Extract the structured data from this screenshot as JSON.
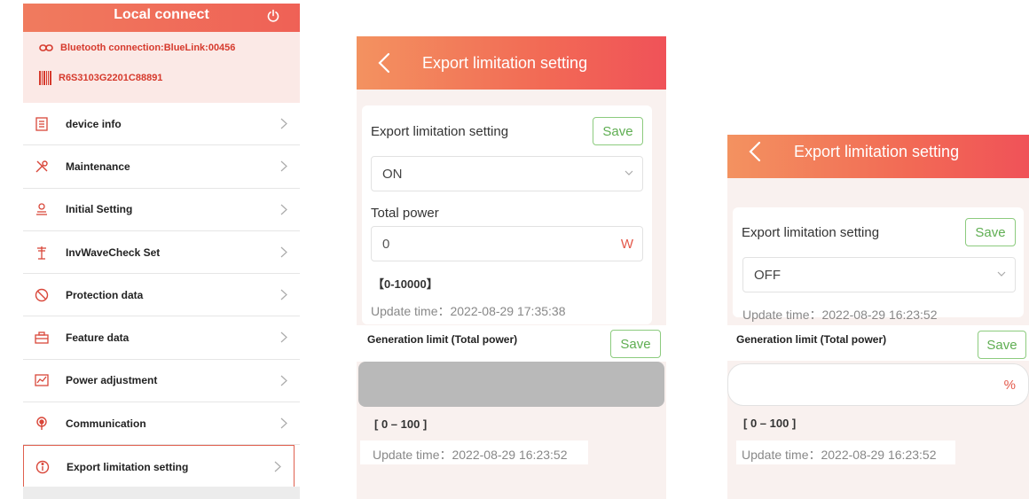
{
  "local": {
    "title": "Local connect",
    "bluetooth": "Bluetooth connection:BlueLink:00456",
    "serial": "R6S3103G2201C88891",
    "menu": [
      {
        "label": "device info",
        "icon": "document-icon"
      },
      {
        "label": "Maintenance",
        "icon": "tools-icon"
      },
      {
        "label": "Initial Setting",
        "icon": "setting-icon"
      },
      {
        "label": "InvWaveCheck Set",
        "icon": "tower-icon"
      },
      {
        "label": "Protection data",
        "icon": "prohibit-icon"
      },
      {
        "label": "Feature data",
        "icon": "toolbox-icon"
      },
      {
        "label": "Power adjustment",
        "icon": "chart-icon"
      },
      {
        "label": "Communication",
        "icon": "antenna-icon"
      },
      {
        "label": "Export limitation setting",
        "icon": "info-icon"
      }
    ],
    "selected_index": 8
  },
  "screen_on": {
    "header_title": "Export limitation setting",
    "setting_label": "Export limitation setting",
    "save_label": "Save",
    "select_value": "ON",
    "total_power_label": "Total power",
    "total_power_value": "0",
    "total_power_unit": "W",
    "total_power_range": "【0-10000】",
    "update_time": "Update time：2022-08-29 17:35:38",
    "gen_limit_label": "Generation limit (Total power)",
    "gen_save_label": "Save",
    "gen_range": "[ 0 – 100 ]",
    "gen_update_time": "Update time：2022-08-29 16:23:52"
  },
  "screen_off": {
    "header_title": "Export limitation setting",
    "setting_label": "Export limitation setting",
    "save_label": "Save",
    "select_value": "OFF",
    "update_time": "Update time：2022-08-29 16:23:52",
    "gen_limit_label": "Generation limit (Total power)",
    "gen_save_label": "Save",
    "gen_unit": "%",
    "gen_range": "[ 0 – 100 ]",
    "gen_update_time": "Update time：2022-08-29 16:23:52"
  },
  "colors": {
    "accent": "#ef6156",
    "header_light": "#f39260",
    "save_green": "#5fae52",
    "unit_red": "#e4584a",
    "blurred_input": "#b9b9b9"
  }
}
